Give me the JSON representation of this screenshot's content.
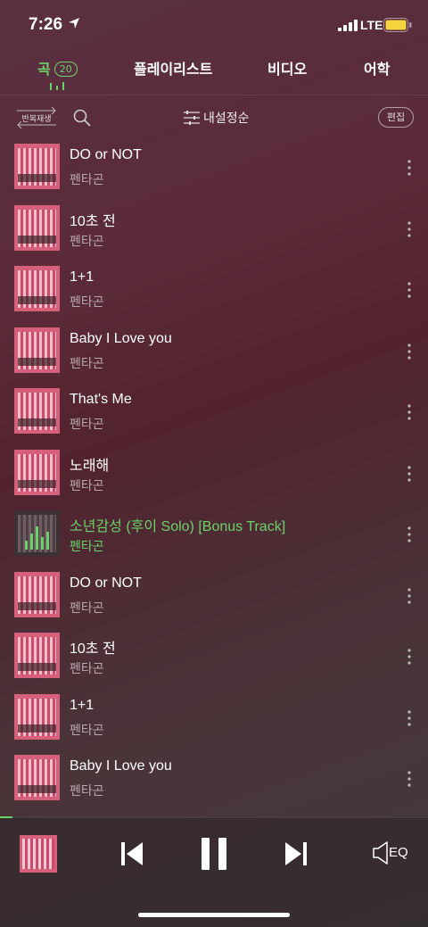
{
  "status_bar": {
    "time": "7:26",
    "network": "LTE"
  },
  "tabs": [
    {
      "label": "곡",
      "count": "20",
      "active": true
    },
    {
      "label": "플레이리스트"
    },
    {
      "label": "비디오"
    },
    {
      "label": "어학"
    }
  ],
  "toolbar": {
    "repeat_label": "반복재생",
    "sort_label": "내설정순",
    "edit_label": "편집"
  },
  "songs": [
    {
      "title": "DO or NOT",
      "artist": "펜타곤"
    },
    {
      "title": "10초 전",
      "artist": "펜타곤"
    },
    {
      "title": "1+1",
      "artist": "펜타곤"
    },
    {
      "title": "Baby I Love you",
      "artist": "펜타곤"
    },
    {
      "title": "That's Me",
      "artist": "펜타곤"
    },
    {
      "title": "노래해",
      "artist": "펜타곤"
    },
    {
      "title": "소년감성 (후이 Solo) [Bonus Track]",
      "artist": "펜타곤",
      "playing": true
    },
    {
      "title": "DO or NOT",
      "artist": "펜타곤"
    },
    {
      "title": "10초 전",
      "artist": "펜타곤"
    },
    {
      "title": "1+1",
      "artist": "펜타곤"
    },
    {
      "title": "Baby I Love you",
      "artist": "펜타곤"
    }
  ],
  "player": {
    "progress": 0.03,
    "eq_label": "EQ"
  },
  "colors": {
    "accent": "#6bd16a"
  }
}
